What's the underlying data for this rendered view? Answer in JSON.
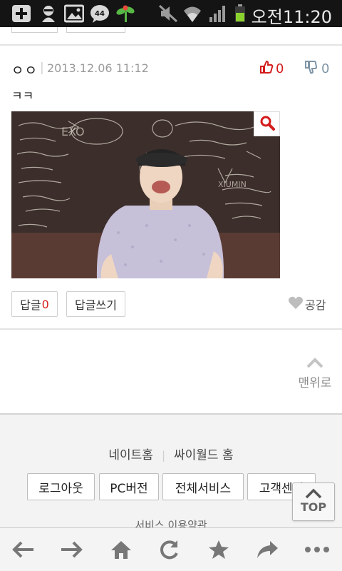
{
  "status_bar": {
    "time": "오전11:20",
    "icons": [
      "add-icon",
      "character-icon",
      "image-icon",
      "messenger-icon",
      "plant-icon",
      "mute-icon",
      "wifi-icon",
      "signal-icon",
      "battery-icon"
    ]
  },
  "comment": {
    "author": "ㅇㅇ",
    "separator": "|",
    "date": "2013.12.06 11:12",
    "like_count": "0",
    "dislike_count": "0",
    "text": "ㅋㅋ",
    "reply_label": "답글",
    "reply_count": "0",
    "write_reply_label": "답글쓰기",
    "empathy_label": "공감"
  },
  "scroll_top_label": "맨위로",
  "footer": {
    "link_home": "네이트홈",
    "link_sep": "|",
    "link_cyworld": "싸이월드 홈",
    "buttons": [
      "로그아웃",
      "PC버전",
      "전체서비스",
      "고객센터"
    ],
    "terms": "서비스 이용약관",
    "top_button": "TOP"
  },
  "nav": {
    "icons": [
      "back-icon",
      "forward-icon",
      "home-icon",
      "refresh-icon",
      "bookmark-star-icon",
      "share-icon",
      "more-icon"
    ]
  },
  "colors": {
    "accent_red": "#d41c1c",
    "dislike_blue": "#7f95a6",
    "status_bar": "#141414",
    "battery_green": "#8bd12e"
  }
}
